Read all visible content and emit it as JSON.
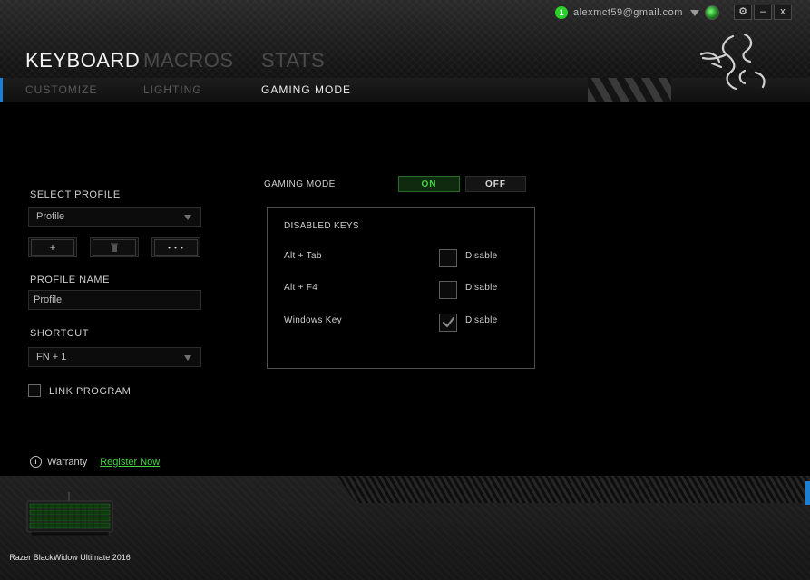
{
  "account": {
    "notification_count": "1",
    "email": "alexmct59@gmail.com"
  },
  "window_controls": {
    "settings": "⚙",
    "minimize": "–",
    "close": "x"
  },
  "main_tabs": [
    {
      "label": "KEYBOARD",
      "active": true
    },
    {
      "label": "MACROS",
      "active": false
    },
    {
      "label": "STATS",
      "active": false
    }
  ],
  "sub_tabs": [
    {
      "label": "CUSTOMIZE",
      "active": false
    },
    {
      "label": "LIGHTING",
      "active": false
    },
    {
      "label": "GAMING MODE",
      "active": true
    }
  ],
  "profile": {
    "select_label": "SELECT PROFILE",
    "selected": "Profile",
    "add_label": "+",
    "more_label": "• • •",
    "name_label": "PROFILE NAME",
    "name_value": "Profile",
    "shortcut_label": "SHORTCUT",
    "shortcut_value": "FN + 1",
    "link_program_label": "LINK PROGRAM"
  },
  "gaming_mode": {
    "label": "GAMING MODE",
    "on_label": "ON",
    "off_label": "OFF",
    "state": "ON",
    "disabled_keys_title": "DISABLED KEYS",
    "keys": [
      {
        "name": "Alt + Tab",
        "checkbox_label": "Disable",
        "checked": false
      },
      {
        "name": "Alt + F4",
        "checkbox_label": "Disable",
        "checked": false
      },
      {
        "name": "Windows Key",
        "checkbox_label": "Disable",
        "checked": true
      }
    ]
  },
  "warranty": {
    "label": "Warranty",
    "link": "Register Now"
  },
  "device": {
    "name": "Razer BlackWidow Ultimate 2016"
  },
  "colors": {
    "accent_green": "#44d444",
    "accent_blue": "#1b7fd6",
    "background": "#000000"
  }
}
